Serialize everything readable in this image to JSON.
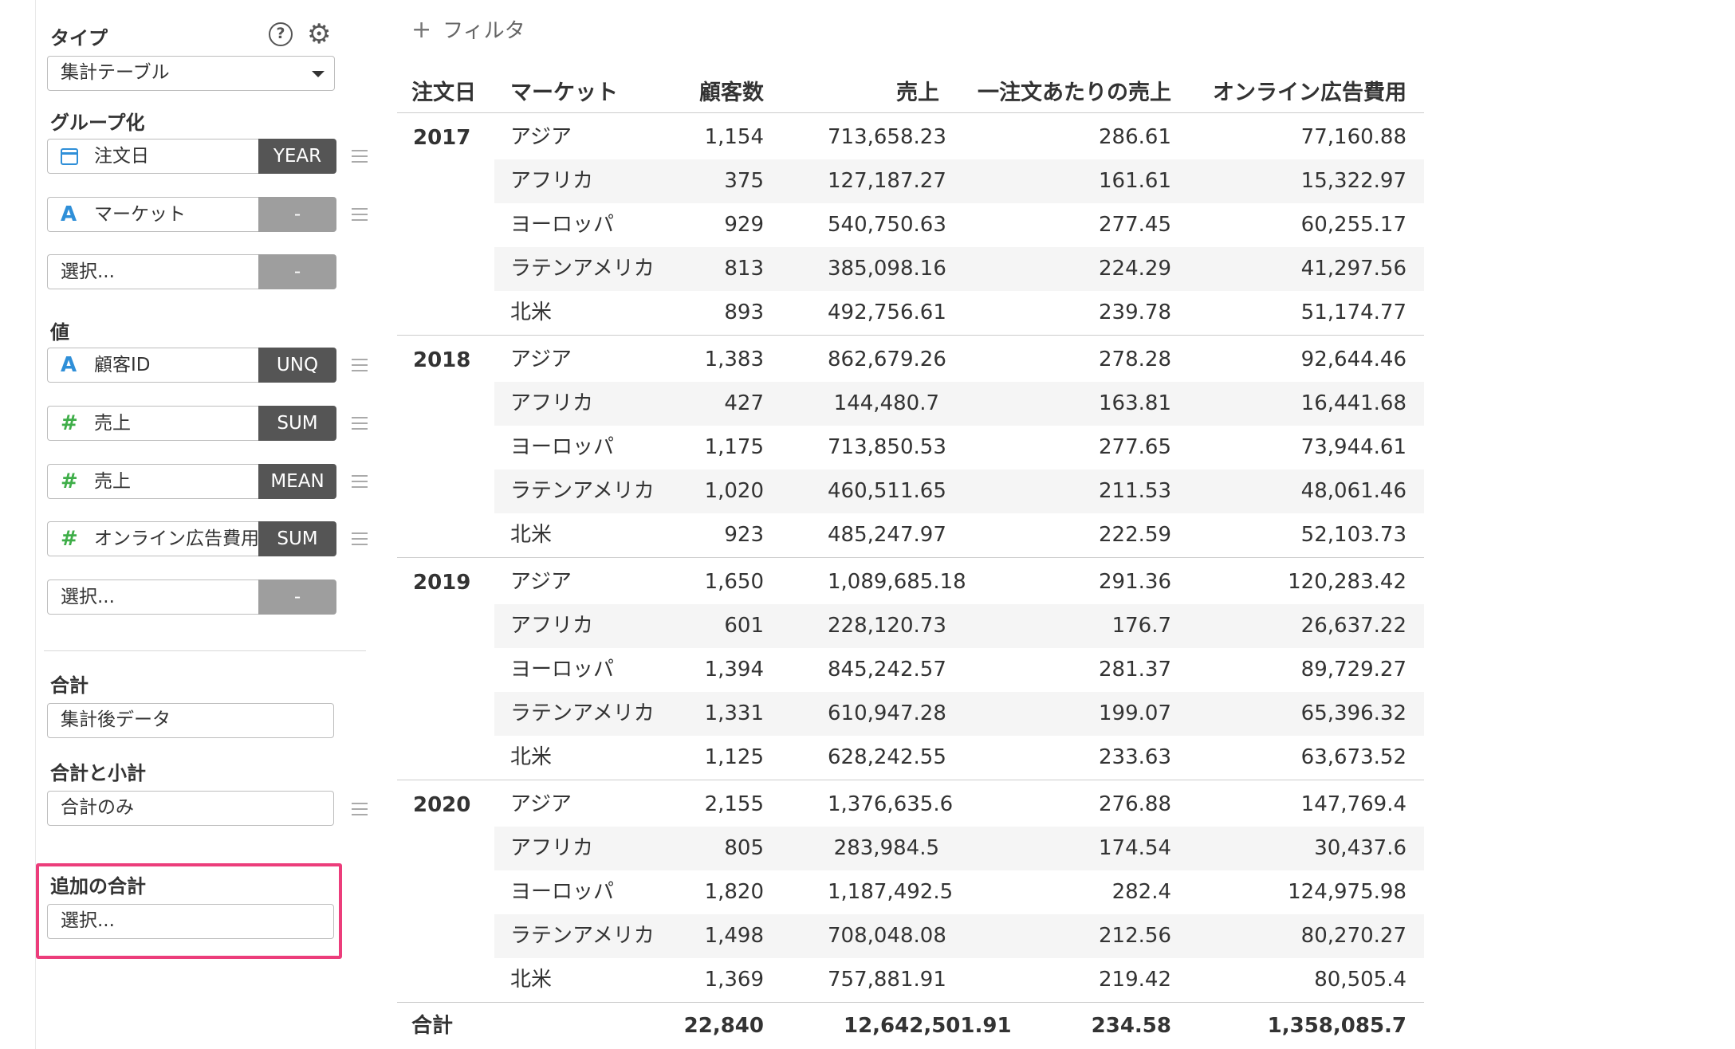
{
  "sidebar": {
    "type_label": "タイプ",
    "help_icon": "?",
    "type_value": "集計テーブル",
    "group_label": "グループ化",
    "group_fields": [
      {
        "icon": "calendar",
        "label": "注文日",
        "agg": "YEAR"
      },
      {
        "icon": "A",
        "label": "マーケット",
        "agg": "-"
      },
      {
        "icon": "",
        "label": "選択...",
        "agg": "-"
      }
    ],
    "value_label": "値",
    "value_fields": [
      {
        "icon": "A",
        "label": "顧客ID",
        "agg": "UNQ"
      },
      {
        "icon": "#",
        "label": "売上",
        "agg": "SUM"
      },
      {
        "icon": "#",
        "label": "売上",
        "agg": "MEAN"
      },
      {
        "icon": "#",
        "label": "オンライン広告費用",
        "agg": "SUM"
      },
      {
        "icon": "",
        "label": "選択...",
        "agg": "-"
      }
    ],
    "total_label": "合計",
    "total_value": "集計後データ",
    "subtotal_label": "合計と小計",
    "subtotal_value": "合計のみ",
    "extra_total_label": "追加の合計",
    "extra_total_placeholder": "選択..."
  },
  "filter_label": "フィルタ",
  "table": {
    "headers": [
      "注文日",
      "マーケット",
      "顧客数",
      "売上",
      "一注文あたりの売上",
      "オンライン広告費用"
    ],
    "groups": [
      {
        "year": "2017",
        "rows": [
          [
            "アジア",
            "1,154",
            "713,658.23",
            "286.61",
            "77,160.88"
          ],
          [
            "アフリカ",
            "375",
            "127,187.27",
            "161.61",
            "15,322.97"
          ],
          [
            "ヨーロッパ",
            "929",
            "540,750.63",
            "277.45",
            "60,255.17"
          ],
          [
            "ラテンアメリカ",
            "813",
            "385,098.16",
            "224.29",
            "41,297.56"
          ],
          [
            "北米",
            "893",
            "492,756.61",
            "239.78",
            "51,174.77"
          ]
        ]
      },
      {
        "year": "2018",
        "rows": [
          [
            "アジア",
            "1,383",
            "862,679.26",
            "278.28",
            "92,644.46"
          ],
          [
            "アフリカ",
            "427",
            "144,480.7",
            "163.81",
            "16,441.68"
          ],
          [
            "ヨーロッパ",
            "1,175",
            "713,850.53",
            "277.65",
            "73,944.61"
          ],
          [
            "ラテンアメリカ",
            "1,020",
            "460,511.65",
            "211.53",
            "48,061.46"
          ],
          [
            "北米",
            "923",
            "485,247.97",
            "222.59",
            "52,103.73"
          ]
        ]
      },
      {
        "year": "2019",
        "rows": [
          [
            "アジア",
            "1,650",
            "1,089,685.18",
            "291.36",
            "120,283.42"
          ],
          [
            "アフリカ",
            "601",
            "228,120.73",
            "176.7",
            "26,637.22"
          ],
          [
            "ヨーロッパ",
            "1,394",
            "845,242.57",
            "281.37",
            "89,729.27"
          ],
          [
            "ラテンアメリカ",
            "1,331",
            "610,947.28",
            "199.07",
            "65,396.32"
          ],
          [
            "北米",
            "1,125",
            "628,242.55",
            "233.63",
            "63,673.52"
          ]
        ]
      },
      {
        "year": "2020",
        "rows": [
          [
            "アジア",
            "2,155",
            "1,376,635.6",
            "276.88",
            "147,769.4"
          ],
          [
            "アフリカ",
            "805",
            "283,984.5",
            "174.54",
            "30,437.6"
          ],
          [
            "ヨーロッパ",
            "1,820",
            "1,187,492.5",
            "282.4",
            "124,975.98"
          ],
          [
            "ラテンアメリカ",
            "1,498",
            "708,048.08",
            "212.56",
            "80,270.27"
          ],
          [
            "北米",
            "1,369",
            "757,881.91",
            "219.42",
            "80,505.4"
          ]
        ]
      }
    ],
    "total": [
      "合計",
      "22,840",
      "12,642,501.91",
      "234.58",
      "1,358,085.7"
    ]
  },
  "colors": {
    "accent_highlight": "#ec3d7b",
    "agg_button": "#555555",
    "agg_button_empty": "#9e9e9e",
    "icon_text_type": "#2f8fd8",
    "icon_number_type": "#3fae49"
  }
}
